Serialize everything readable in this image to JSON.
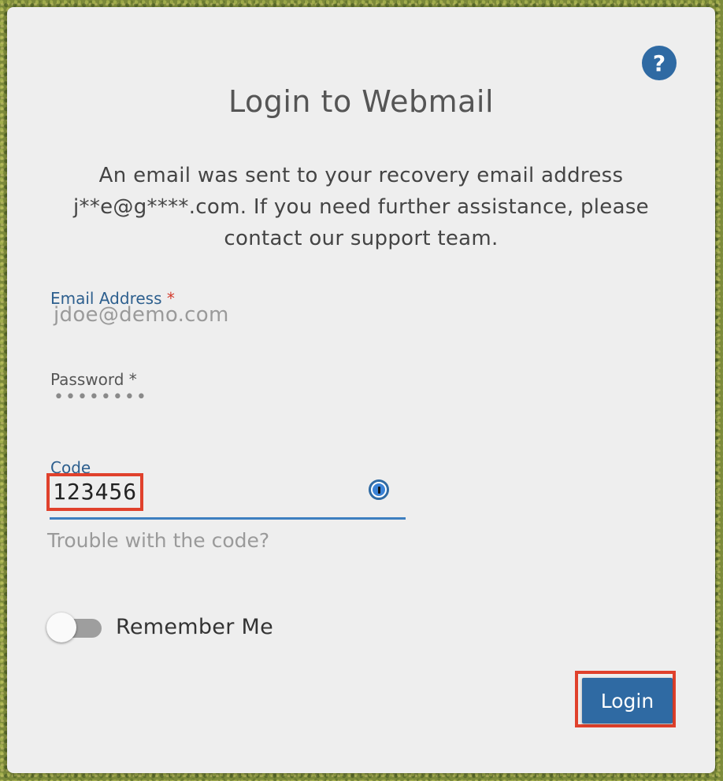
{
  "dialog": {
    "title": "Login to Webmail",
    "help_symbol": "?",
    "message": "An email was sent to your recovery email address j**e@g****.com. If you need further assistance, please contact our support team."
  },
  "form": {
    "email": {
      "label": "Email Address",
      "required_mark": "*",
      "value": "jdoe@demo.com"
    },
    "password": {
      "label": "Password",
      "required_mark": "*",
      "value": "••••••••"
    },
    "code": {
      "label": "Code",
      "value": "123456",
      "manager_icon": "password-manager-icon"
    },
    "trouble_link": "Trouble with the code?",
    "remember_me": {
      "label": "Remember Me",
      "enabled": false
    },
    "submit_label": "Login"
  },
  "colors": {
    "accent": "#2f6aa3",
    "highlight": "#e0412c",
    "required": "#d33a2c"
  }
}
